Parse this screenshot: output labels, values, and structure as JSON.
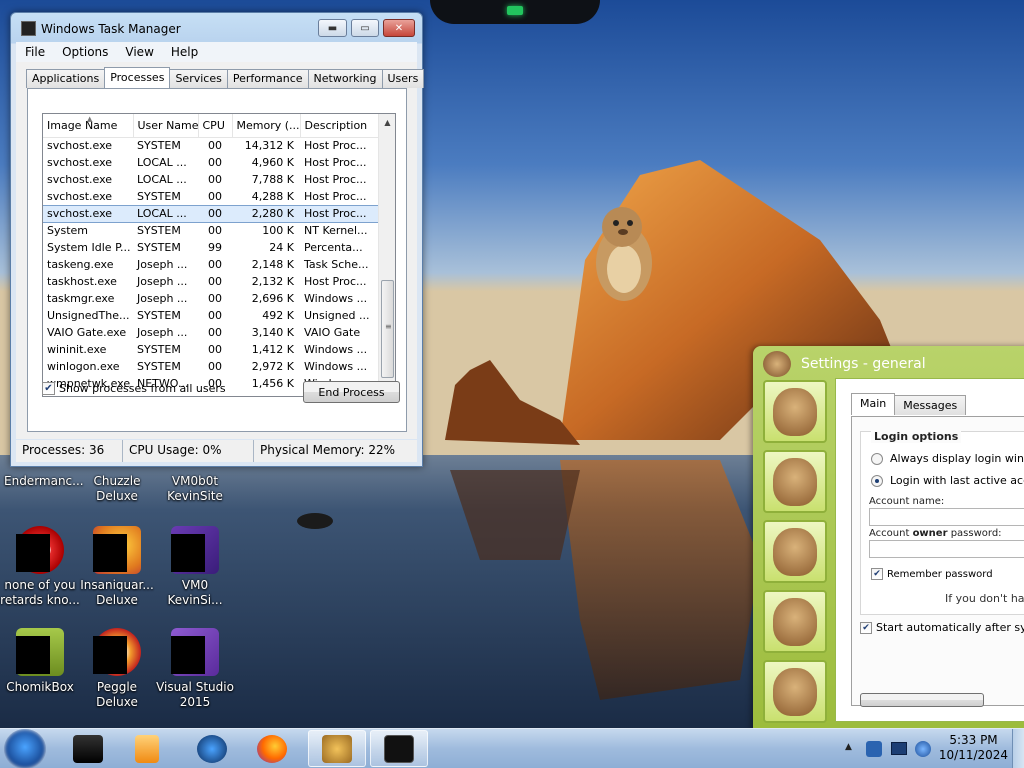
{
  "task_manager": {
    "title": "Windows Task Manager",
    "menu": [
      "File",
      "Options",
      "View",
      "Help"
    ],
    "tabs": [
      "Applications",
      "Processes",
      "Services",
      "Performance",
      "Networking",
      "Users"
    ],
    "active_tab": "Processes",
    "columns": [
      "Image Name",
      "User Name",
      "CPU",
      "Memory (...",
      "Description"
    ],
    "rows": [
      [
        "svchost.exe",
        "SYSTEM",
        "00",
        "14,312 K",
        "Host Proc..."
      ],
      [
        "svchost.exe",
        "LOCAL ...",
        "00",
        "4,960 K",
        "Host Proc..."
      ],
      [
        "svchost.exe",
        "LOCAL ...",
        "00",
        "7,788 K",
        "Host Proc..."
      ],
      [
        "svchost.exe",
        "SYSTEM",
        "00",
        "4,288 K",
        "Host Proc..."
      ],
      [
        "svchost.exe",
        "LOCAL ...",
        "00",
        "2,280 K",
        "Host Proc..."
      ],
      [
        "System",
        "SYSTEM",
        "00",
        "100 K",
        "NT Kernel..."
      ],
      [
        "System Idle P...",
        "SYSTEM",
        "99",
        "24 K",
        "Percenta..."
      ],
      [
        "taskeng.exe",
        "Joseph ...",
        "00",
        "2,148 K",
        "Task Sche..."
      ],
      [
        "taskhost.exe",
        "Joseph ...",
        "00",
        "2,132 K",
        "Host Proc..."
      ],
      [
        "taskmgr.exe",
        "Joseph ...",
        "00",
        "2,696 K",
        "Windows ..."
      ],
      [
        "UnsignedThe...",
        "SYSTEM",
        "00",
        "492 K",
        "Unsigned ..."
      ],
      [
        "VAIO Gate.exe",
        "Joseph ...",
        "00",
        "3,140 K",
        "VAIO Gate"
      ],
      [
        "wininit.exe",
        "SYSTEM",
        "00",
        "1,412 K",
        "Windows ..."
      ],
      [
        "winlogon.exe",
        "SYSTEM",
        "00",
        "2,972 K",
        "Windows ..."
      ],
      [
        "wmpnetwk.exe",
        "NETWO...",
        "00",
        "1,456 K",
        "Windows ..."
      ]
    ],
    "selected_row_index": 4,
    "show_all_label": "Show processes from all users",
    "show_all_checked": true,
    "end_process_label": "End Process",
    "status": {
      "processes": "Processes: 36",
      "cpu": "CPU Usage: 0%",
      "memory": "Physical Memory: 22%"
    }
  },
  "desktop": {
    "top_labels": [
      "Endermanc...",
      "Chuzzle Deluxe",
      "VM0b0t KevinSite"
    ],
    "icons": [
      {
        "label": "none of you retards kno...",
        "icon": "opera-like-icon"
      },
      {
        "label": "Insaniquar... Deluxe",
        "icon": "bird-icon"
      },
      {
        "label": "VM0 KevinSi...",
        "icon": "vm-icon"
      },
      {
        "label": "ChomikBox",
        "icon": "hamster-icon"
      },
      {
        "label": "Peggle Deluxe",
        "icon": "peggle-icon"
      },
      {
        "label": "Visual Studio 2015",
        "icon": "visual-studio-icon"
      }
    ]
  },
  "settings": {
    "title": "Settings - general",
    "tabs": [
      "Main",
      "Messages"
    ],
    "active_tab": "Main",
    "group_title": "Login options",
    "radio_1": "Always display login window",
    "radio_2": "Login with last active accoun",
    "radio_selected": 2,
    "account_name_label": "Account name:",
    "password_label_pre": "Account ",
    "password_label_bold": "owner",
    "password_label_post": " password:",
    "remember_label": "Remember password",
    "remember_checked": true,
    "hint": "If you don't have",
    "start_auto_label": "Start automatically after syster",
    "start_auto_checked": true
  },
  "taskbar": {
    "time": "5:33 PM",
    "date": "10/11/2024",
    "items": [
      "device-icon",
      "media-player-icon",
      "network-globe-icon",
      "firefox-icon",
      "settings-gears-icon",
      "task-manager-icon"
    ]
  }
}
